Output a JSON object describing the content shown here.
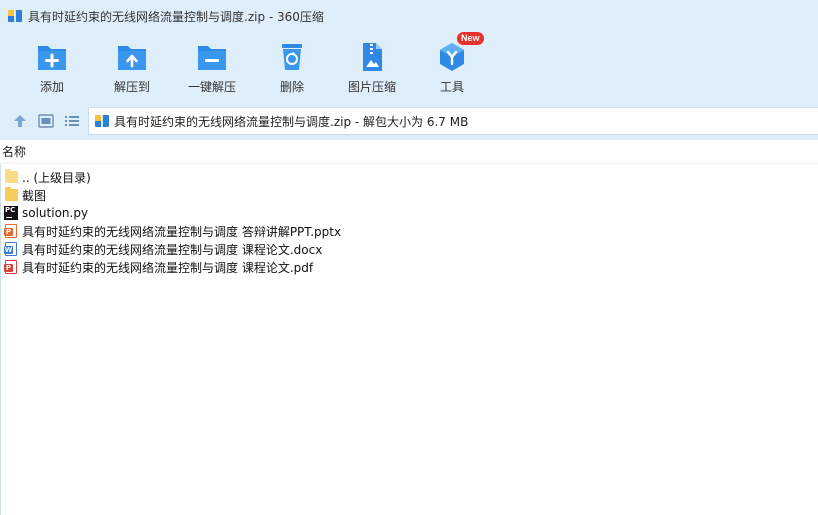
{
  "window": {
    "title": "具有时延约束的无线网络流量控制与调度.zip - 360压缩"
  },
  "toolbar": {
    "items": [
      {
        "label": "添加",
        "icon": "add-folder-icon"
      },
      {
        "label": "解压到",
        "icon": "extract-to-icon"
      },
      {
        "label": "一键解压",
        "icon": "one-click-extract-icon"
      },
      {
        "label": "删除",
        "icon": "recycle-delete-icon"
      },
      {
        "label": "图片压缩",
        "icon": "image-compress-icon"
      },
      {
        "label": "工具",
        "icon": "tools-icon",
        "badge": "New"
      }
    ]
  },
  "nav": {
    "path": "具有时延约束的无线网络流量控制与调度.zip - 解包大小为 6.7 MB"
  },
  "list": {
    "header_name": "名称",
    "files": [
      {
        "name": ".. (上级目录)",
        "type": "parent-folder"
      },
      {
        "name": "截图",
        "type": "folder"
      },
      {
        "name": "solution.py",
        "type": "python"
      },
      {
        "name": "具有时延约束的无线网络流量控制与调度 答辩讲解PPT.pptx",
        "type": "pptx"
      },
      {
        "name": "具有时延约束的无线网络流量控制与调度 课程论文.docx",
        "type": "docx"
      },
      {
        "name": "具有时延约束的无线网络流量控制与调度 课程论文.pdf",
        "type": "pdf"
      }
    ]
  },
  "colors": {
    "chrome_bg": "#dfeefb",
    "accent_blue": "#2e8ae6",
    "new_badge": "#e8302c"
  }
}
